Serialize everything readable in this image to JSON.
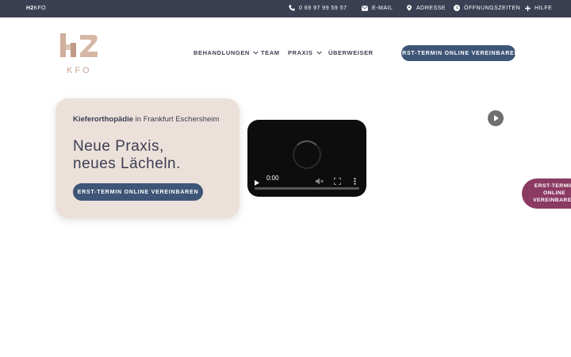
{
  "topbar": {
    "brand_bold": "H2",
    "brand_rest": "KFO",
    "phone": "0 69 97 99 59 57",
    "email": "E-MAIL",
    "address": "ADRESSE",
    "hours": "ÖFFNUNGSZEITEN",
    "help": "HILFE"
  },
  "header": {
    "logo_text": "KFO",
    "nav": {
      "treatments": "BEHANDLUNGEN",
      "team": "TEAM",
      "practice": "PRAXIS",
      "referrer": "ÜBERWEISER"
    },
    "cta": "ERST-TERMIN ONLINE VEREINBAREN"
  },
  "hero": {
    "subtitle_bold": "Kieferorthopädie",
    "subtitle_rest": " in Frankfurt Eschersheim",
    "title_line1": "Neue Praxis,",
    "title_line2": "neues Lächeln.",
    "cta": "ERST-TERMIN ONLINE VEREINBAREN"
  },
  "video": {
    "time": "0:00"
  },
  "side_cta": "ERST-TERMIN ONLINE VEREINBAREN",
  "colors": {
    "topbar_bg": "#3b3f52",
    "button_bg": "#3e5577",
    "card_bg": "#ece0da",
    "logo_accent": "#c7a48f",
    "side_cta_bg": "#8b3a62"
  },
  "icons": {
    "phone": "phone-icon",
    "email": "mail-icon",
    "address": "location-pin-icon",
    "hours": "clock-icon",
    "help": "plus-icon"
  }
}
